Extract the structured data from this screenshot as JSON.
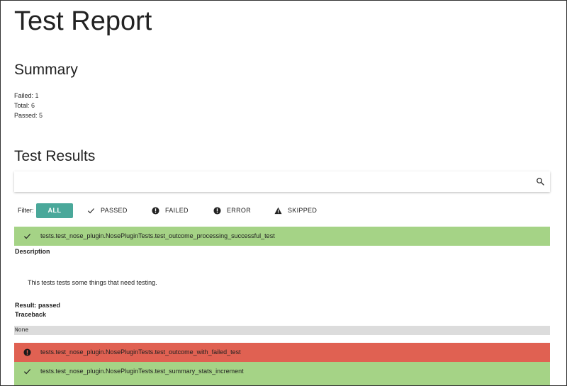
{
  "report": {
    "title": "Test Report"
  },
  "summary": {
    "heading": "Summary",
    "failed_label": "Failed:",
    "failed_value": "1",
    "total_label": "Total:",
    "total_value": "6",
    "passed_label": "Passed:",
    "passed_value": "5"
  },
  "results": {
    "heading": "Test Results",
    "search": {
      "value": "",
      "placeholder": "",
      "icon": "search-icon"
    },
    "filter": {
      "label": "Filter:",
      "all": "ALL",
      "passed": "PASSED",
      "failed": "FAILED",
      "error": "ERROR",
      "skipped": "SKIPPED"
    },
    "items": [
      {
        "name": "tests.test_nose_plugin.NosePluginTests.test_outcome_processing_successful_test",
        "status": "passed",
        "icon": "check-icon",
        "description_label": "Description",
        "description": "This tests tests some things that need testing.",
        "result_text": "Result: passed",
        "traceback_label": "Traceback",
        "traceback": "None"
      },
      {
        "name": "tests.test_nose_plugin.NosePluginTests.test_outcome_with_failed_test",
        "status": "failed",
        "icon": "error-circle-icon"
      },
      {
        "name": "tests.test_nose_plugin.NosePluginTests.test_summary_stats_increment",
        "status": "passed",
        "icon": "check-icon"
      }
    ]
  },
  "colors": {
    "passed": "#a5d386",
    "failed": "#e06152",
    "accent": "#4aa89a",
    "traceback_bg": "#dcdcdc"
  }
}
